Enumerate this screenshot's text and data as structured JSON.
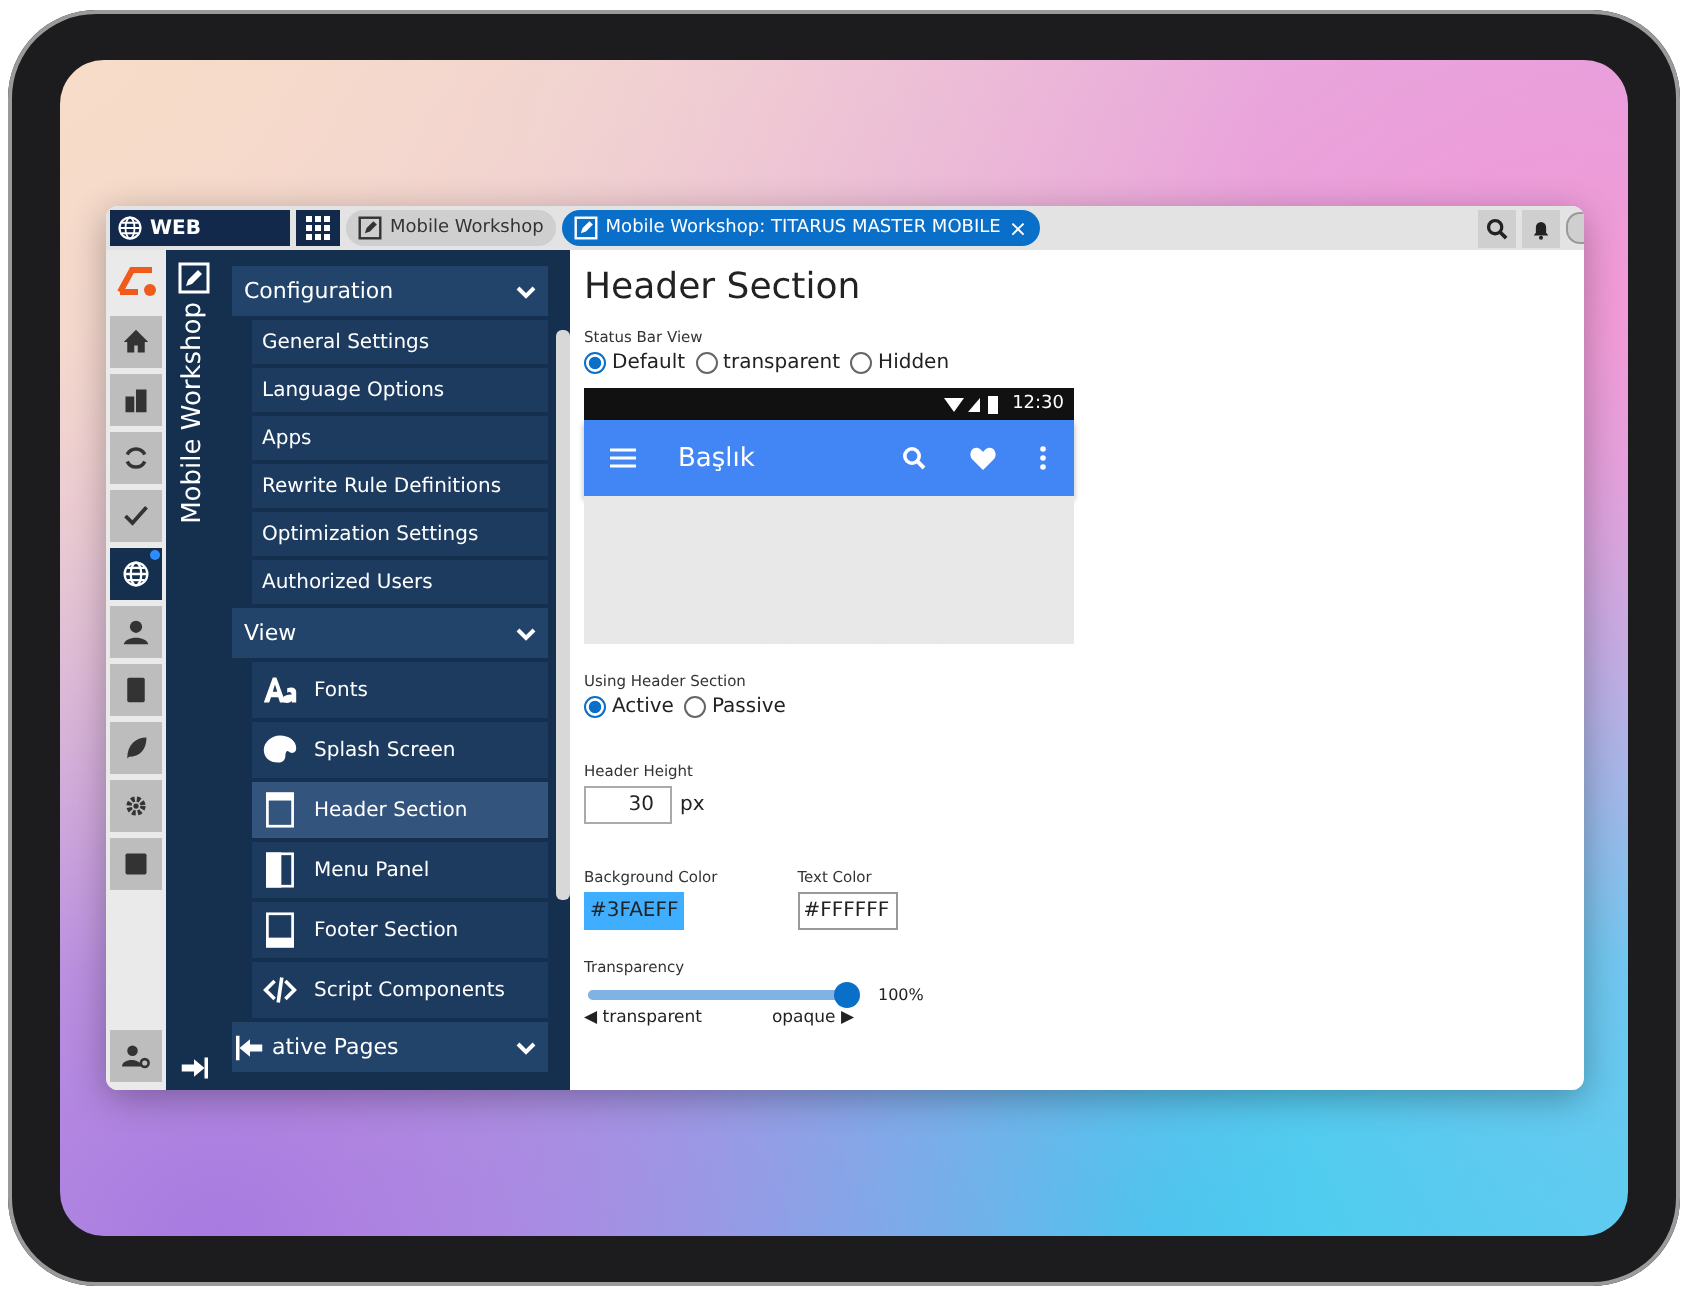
{
  "top_bar": {
    "app": "WEB",
    "tabs": [
      {
        "label": "Mobile Workshop",
        "selected": false,
        "closable": false
      },
      {
        "label": "Mobile Workshop: TITARUS MASTER MOBILE",
        "selected": true,
        "closable": true
      }
    ],
    "close": "×"
  },
  "rail": [
    {
      "selected": false
    },
    {
      "selected": false
    },
    {
      "selected": false
    },
    {
      "selected": false
    },
    {
      "selected": true,
      "badge": true
    },
    {
      "selected": false
    },
    {
      "selected": false
    },
    {
      "selected": false
    },
    {
      "selected": false
    },
    {
      "selected": false
    }
  ],
  "module_title": "Mobile Workshop",
  "menu": [
    {
      "label": "Configuration",
      "expanded": true,
      "children": [
        {
          "label": "General Settings",
          "selected": false
        },
        {
          "label": "Language Options",
          "selected": false
        },
        {
          "label": "Apps",
          "selected": false
        },
        {
          "label": "Rewrite Rule Definitions",
          "selected": false
        },
        {
          "label": "Optimization Settings",
          "selected": false
        },
        {
          "label": "Authorized Users",
          "selected": false
        }
      ]
    },
    {
      "label": "View",
      "expanded": true,
      "children": [
        {
          "label": "Fonts",
          "selected": false
        },
        {
          "label": "Splash Screen",
          "selected": false
        },
        {
          "label": "Header Section",
          "selected": true
        },
        {
          "label": "Menu Panel",
          "selected": false
        },
        {
          "label": "Footer Section",
          "selected": false
        },
        {
          "label": "Script Components",
          "selected": false
        }
      ]
    },
    {
      "label": "ative Pages",
      "expanded": true
    }
  ],
  "content": {
    "title": "Header Section",
    "status_bar_view": {
      "label": "Status Bar View",
      "options": [
        {
          "label": "Default",
          "selected": true
        },
        {
          "label": "transparent",
          "selected": false
        },
        {
          "label": "Hidden",
          "selected": false
        }
      ]
    },
    "preview": {
      "time": "12:30",
      "title": "Başlık"
    },
    "using_header": {
      "label": "Using Header Section",
      "options": [
        {
          "label": "Active",
          "selected": true
        },
        {
          "label": "Passive",
          "selected": false
        }
      ]
    },
    "header_height": {
      "label": "Header Height",
      "value": "30",
      "unit": "px"
    },
    "background_color": {
      "label": "Background Color",
      "value": "#3FAEFF"
    },
    "text_color": {
      "label": "Text Color",
      "value": "#FFFFFF"
    },
    "transparency": {
      "label": "Transparency",
      "level": 1,
      "reading": "100%",
      "min_label": "◀ transparent",
      "max_label": "opaque ▶"
    }
  }
}
